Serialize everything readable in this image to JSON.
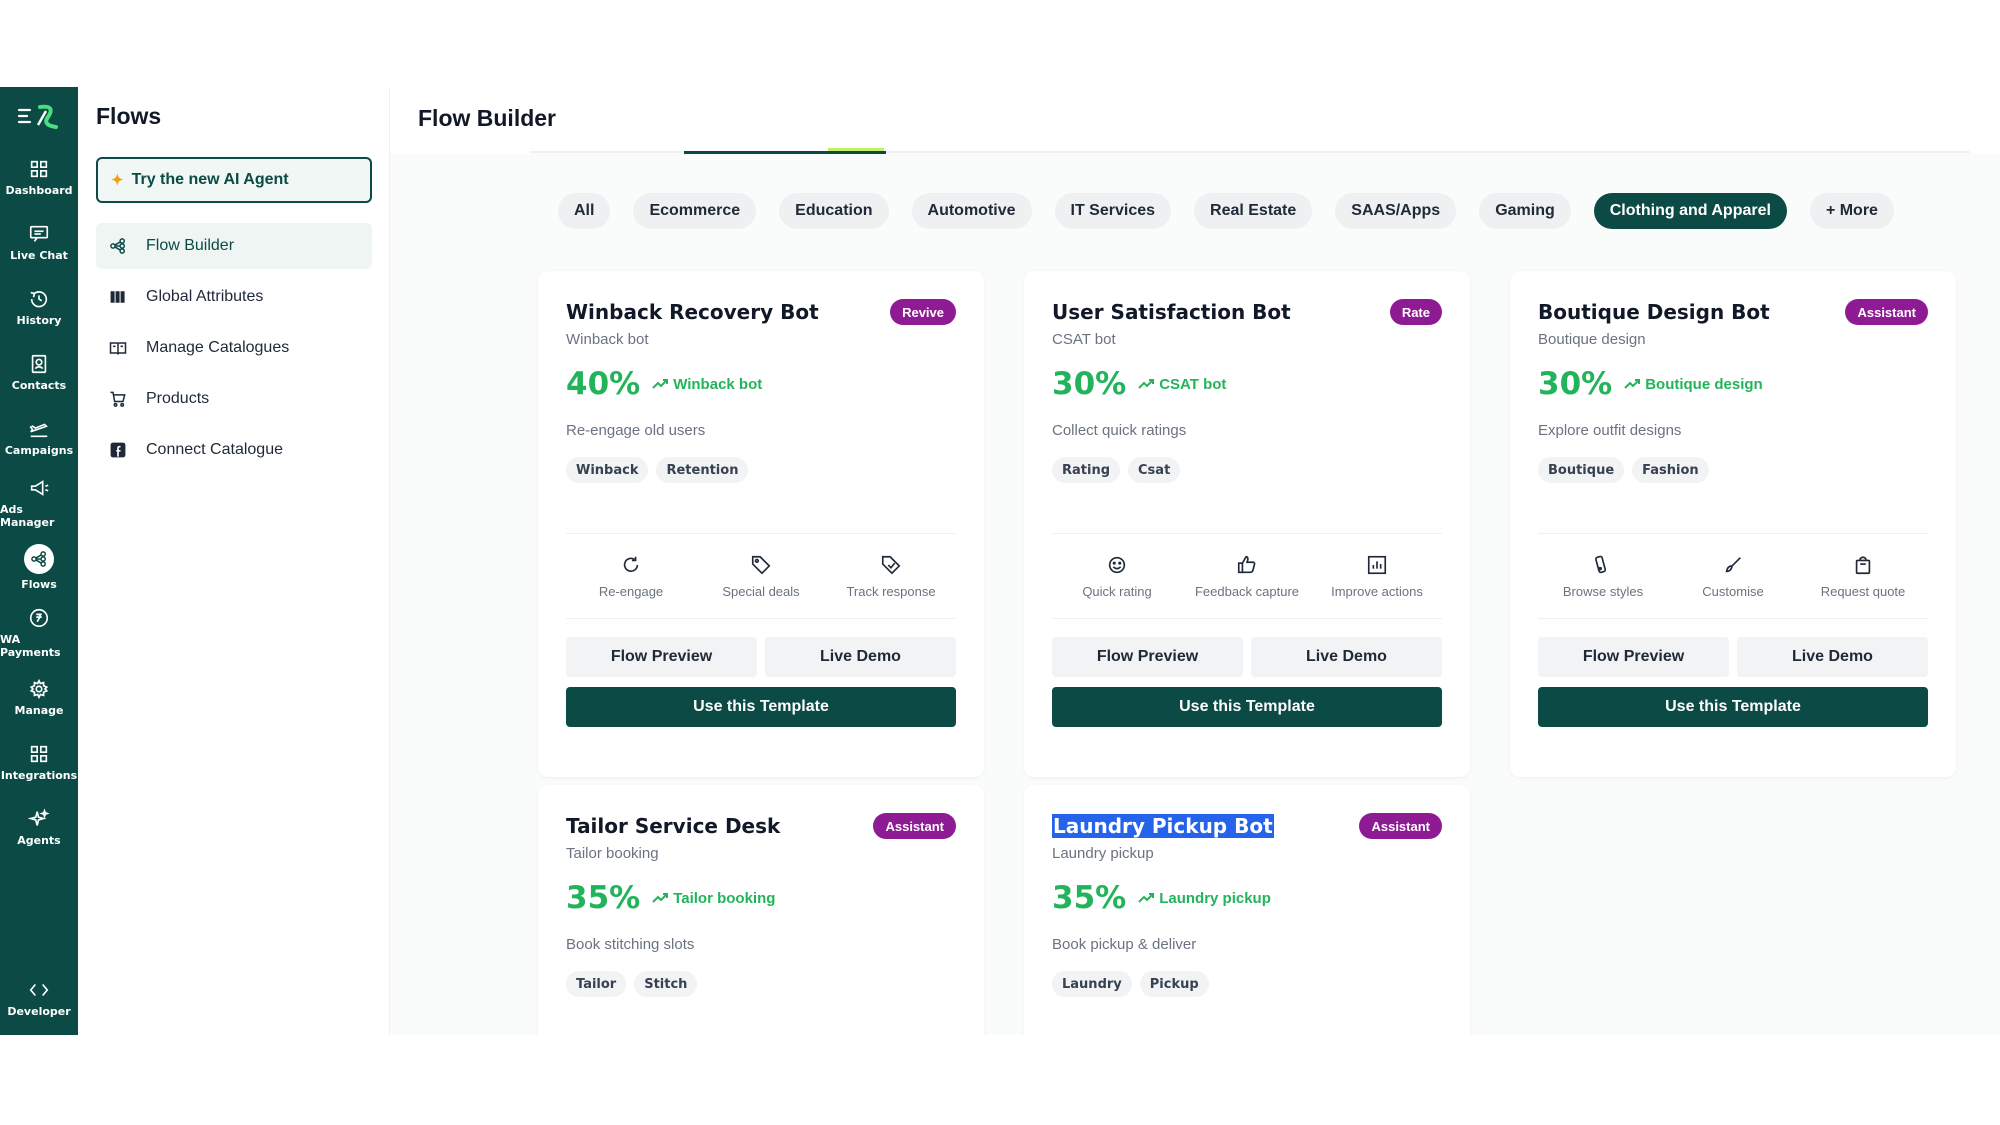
{
  "rail": {
    "items": [
      {
        "label": "Dashboard",
        "icon": "dashboard-icon"
      },
      {
        "label": "Live Chat",
        "icon": "chat-icon"
      },
      {
        "label": "History",
        "icon": "history-icon"
      },
      {
        "label": "Contacts",
        "icon": "contacts-icon"
      },
      {
        "label": "Campaigns",
        "icon": "plane-icon"
      },
      {
        "label": "Ads Manager",
        "icon": "megaphone-icon"
      },
      {
        "label": "Flows",
        "icon": "flows-icon"
      },
      {
        "label": "WA Payments",
        "icon": "rupee-icon"
      },
      {
        "label": "Manage",
        "icon": "gear-icon"
      },
      {
        "label": "Integrations",
        "icon": "grid-icon"
      },
      {
        "label": "Agents",
        "icon": "sparkle-icon"
      }
    ],
    "developer": "Developer"
  },
  "sidebar": {
    "title": "Flows",
    "ai_button": "Try the new AI Agent",
    "items": [
      {
        "label": "Flow Builder"
      },
      {
        "label": "Global Attributes"
      },
      {
        "label": "Manage Catalogues"
      },
      {
        "label": "Products"
      },
      {
        "label": "Connect Catalogue"
      }
    ]
  },
  "main": {
    "title": "Flow Builder",
    "filters": [
      "All",
      "Ecommerce",
      "Education",
      "Automotive",
      "IT Services",
      "Real Estate",
      "SAAS/Apps",
      "Gaming",
      "Clothing and Apparel",
      "+ More"
    ],
    "active_filter": "Clothing and Apparel",
    "cards": [
      {
        "title": "Winback Recovery Bot",
        "badge": "Revive",
        "subtitle": "Winback bot",
        "stat": "40%",
        "trend": "Winback bot",
        "description": "Re-engage old users",
        "tags": [
          "Winback",
          "Retention"
        ],
        "features": [
          {
            "label": "Re-engage",
            "icon": "refresh-icon"
          },
          {
            "label": "Special deals",
            "icon": "tag-icon"
          },
          {
            "label": "Track response",
            "icon": "tag-check-icon"
          }
        ],
        "preview": "Flow Preview",
        "demo": "Live Demo",
        "use": "Use this Template"
      },
      {
        "title": "User Satisfaction Bot",
        "badge": "Rate",
        "subtitle": "CSAT bot",
        "stat": "30%",
        "trend": "CSAT bot",
        "description": "Collect quick ratings",
        "tags": [
          "Rating",
          "Csat"
        ],
        "features": [
          {
            "label": "Quick rating",
            "icon": "smile-icon"
          },
          {
            "label": "Feedback capture",
            "icon": "thumbs-up-icon"
          },
          {
            "label": "Improve actions",
            "icon": "bar-chart-icon"
          }
        ],
        "preview": "Flow Preview",
        "demo": "Live Demo",
        "use": "Use this Template"
      },
      {
        "title": "Boutique Design Bot",
        "badge": "Assistant",
        "subtitle": "Boutique design",
        "stat": "30%",
        "trend": "Boutique design",
        "description": "Explore outfit designs",
        "tags": [
          "Boutique",
          "Fashion"
        ],
        "features": [
          {
            "label": "Browse styles",
            "icon": "swatch-icon"
          },
          {
            "label": "Customise",
            "icon": "brush-icon"
          },
          {
            "label": "Request quote",
            "icon": "bag-icon"
          }
        ],
        "preview": "Flow Preview",
        "demo": "Live Demo",
        "use": "Use this Template"
      },
      {
        "title": "Tailor Service Desk",
        "badge": "Assistant",
        "subtitle": "Tailor booking",
        "stat": "35%",
        "trend": "Tailor booking",
        "description": "Book stitching slots",
        "tags": [
          "Tailor",
          "Stitch"
        ]
      },
      {
        "title": "Laundry Pickup Bot",
        "badge": "Assistant",
        "subtitle": "Laundry pickup",
        "stat": "35%",
        "trend": "Laundry pickup",
        "description": "Book pickup & deliver",
        "tags": [
          "Laundry",
          "Pickup"
        ]
      }
    ]
  },
  "colors": {
    "brand": "#0b4a45",
    "accent_green": "#22b45a",
    "badge_purple": "#8e1b93"
  }
}
